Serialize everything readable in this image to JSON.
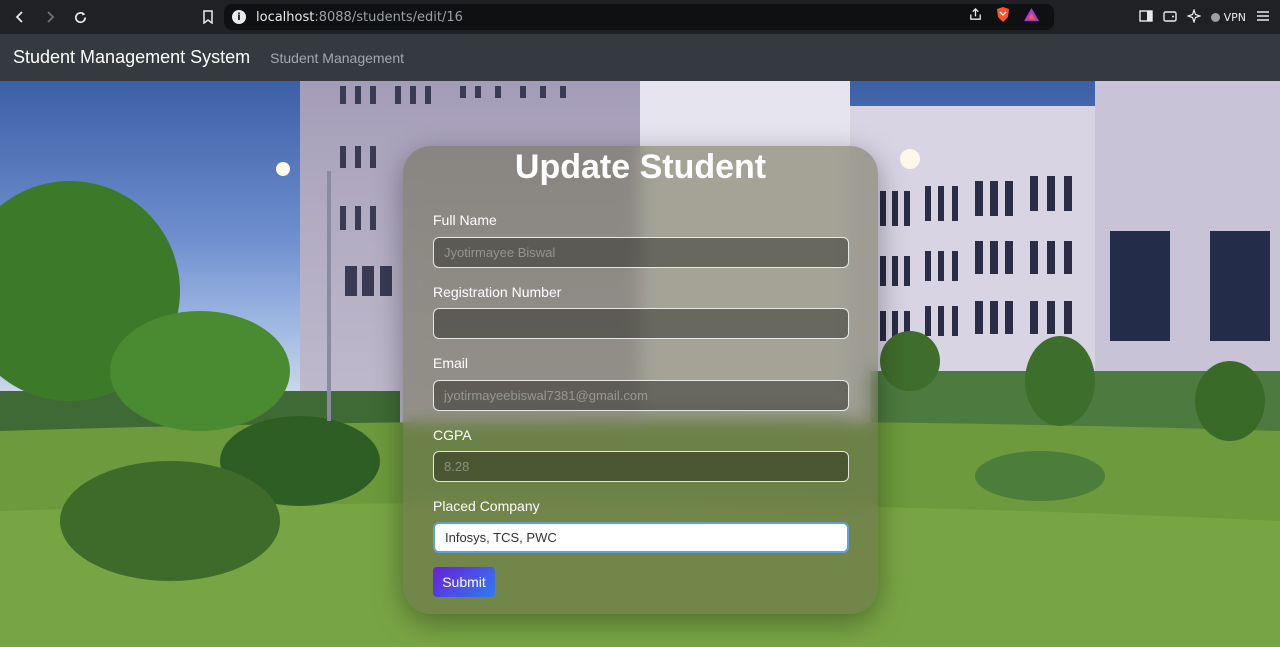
{
  "browser": {
    "url_host": "localhost",
    "url_rest": ":8088/students/edit/16",
    "vpn_label": "VPN"
  },
  "navbar": {
    "brand": "Student Management System",
    "link": "Student Management"
  },
  "form": {
    "title": "Update Student",
    "fields": [
      {
        "label": "Full Name",
        "value": "Jyotirmayee Biswal"
      },
      {
        "label": "Registration Number",
        "value": ""
      },
      {
        "label": "Email",
        "value": "jyotirmayeebiswal7381@gmail.com"
      },
      {
        "label": "CGPA",
        "value": "8.28"
      },
      {
        "label": "Placed Company",
        "value": "Infosys, TCS, PWC"
      }
    ],
    "submit_label": "Submit"
  },
  "colors": {
    "navbar_bg": "#343a40",
    "submit_gradient_start": "#6a1fd8",
    "submit_gradient_end": "#2d7cf0"
  }
}
